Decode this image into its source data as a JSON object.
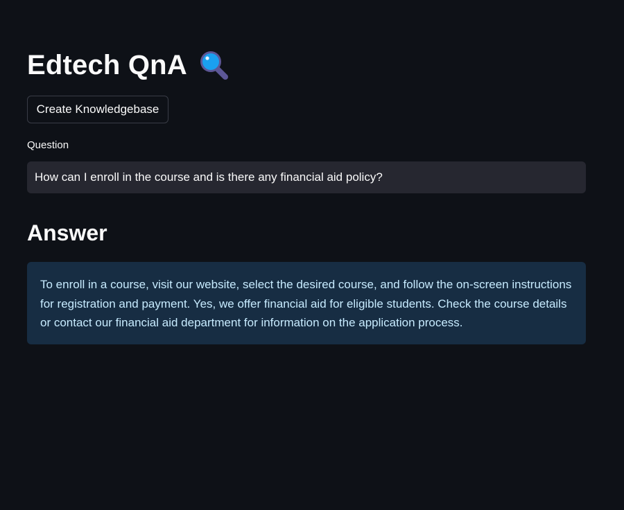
{
  "header": {
    "title": "Edtech QnA",
    "title_icon": "magnifying-glass-icon"
  },
  "actions": {
    "create_kb_label": "Create Knowledgebase"
  },
  "question": {
    "label": "Question",
    "value": "How can I enroll in the course and is there any financial aid policy?"
  },
  "answer": {
    "heading": "Answer",
    "text": "To enroll in a course, visit our website, select the desired course, and follow the on-screen instructions for registration and payment. Yes, we offer financial aid for eligible students. Check the course details or contact our financial aid department for information on the application process."
  },
  "colors": {
    "background": "#0e1117",
    "input_background": "#262730",
    "info_background": "#172d43",
    "info_text": "#c7ebff",
    "text": "#fafafa"
  }
}
